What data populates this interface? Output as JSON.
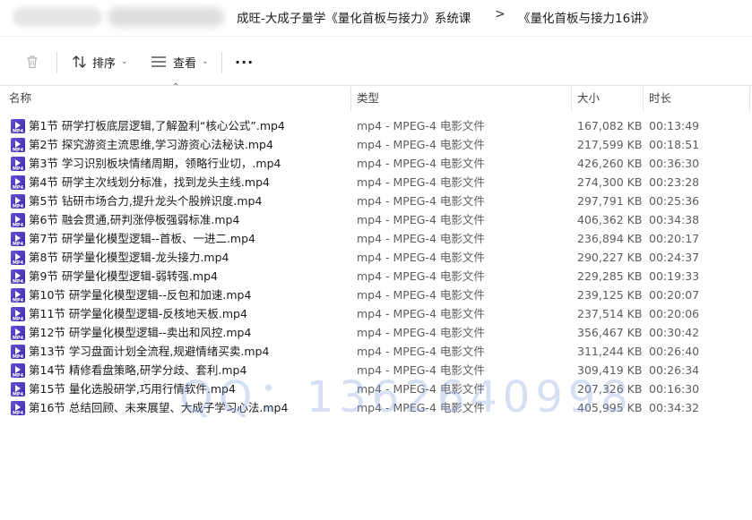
{
  "breadcrumb": {
    "items": [
      "成旺-大成子量学《量化首板与接力》系统课",
      "《量化首板与接力16讲》"
    ],
    "separator": ">"
  },
  "toolbar": {
    "sort_label": "排序",
    "view_label": "查看",
    "more_label": "···"
  },
  "columns": {
    "name": "名称",
    "type": "类型",
    "size": "大小",
    "duration": "时长"
  },
  "files": [
    {
      "name": "第1节 研学打板底层逻辑,了解盈利“核心公式”.mp4",
      "type": "mp4 - MPEG-4 电影文件",
      "size": "167,082 KB",
      "duration": "00:13:49"
    },
    {
      "name": "第2节 探究游资主流思维,学习游资心法秘诀.mp4",
      "type": "mp4 - MPEG-4 电影文件",
      "size": "217,599 KB",
      "duration": "00:18:51"
    },
    {
      "name": "第3节 学习识别板块情绪周期，领略行业切，.mp4",
      "type": "mp4 - MPEG-4 电影文件",
      "size": "426,260 KB",
      "duration": "00:36:30"
    },
    {
      "name": "第4节 研学主次线划分标准，找到龙头主线.mp4",
      "type": "mp4 - MPEG-4 电影文件",
      "size": "274,300 KB",
      "duration": "00:23:28"
    },
    {
      "name": "第5节 钻研市场合力,提升龙头个股辨识度.mp4",
      "type": "mp4 - MPEG-4 电影文件",
      "size": "297,791 KB",
      "duration": "00:25:36"
    },
    {
      "name": "第6节 融会贯通,研判涨停板强弱标准.mp4",
      "type": "mp4 - MPEG-4 电影文件",
      "size": "406,362 KB",
      "duration": "00:34:38"
    },
    {
      "name": "第7节 研学量化模型逻辑--首板、一进二.mp4",
      "type": "mp4 - MPEG-4 电影文件",
      "size": "236,894 KB",
      "duration": "00:20:17"
    },
    {
      "name": "第8节 研学量化模型逻辑-龙头接力.mp4",
      "type": "mp4 - MPEG-4 电影文件",
      "size": "290,227 KB",
      "duration": "00:24:37"
    },
    {
      "name": "第9节 研学量化模型逻辑-弱转强.mp4",
      "type": "mp4 - MPEG-4 电影文件",
      "size": "229,285 KB",
      "duration": "00:19:33"
    },
    {
      "name": "第10节 研学量化模型逻辑--反包和加速.mp4",
      "type": "mp4 - MPEG-4 电影文件",
      "size": "239,125 KB",
      "duration": "00:20:07"
    },
    {
      "name": "第11节 研学量化模型逻辑-反核地天板.mp4",
      "type": "mp4 - MPEG-4 电影文件",
      "size": "237,514 KB",
      "duration": "00:20:06"
    },
    {
      "name": "第12节 研学量化模型逻辑--卖出和风控.mp4",
      "type": "mp4 - MPEG-4 电影文件",
      "size": "356,467 KB",
      "duration": "00:30:42"
    },
    {
      "name": "第13节 学习盘面计划全流程,规避情绪买卖.mp4",
      "type": "mp4 - MPEG-4 电影文件",
      "size": "311,244 KB",
      "duration": "00:26:40"
    },
    {
      "name": "第14节 精修看盘策略,研学分歧、套利.mp4",
      "type": "mp4 - MPEG-4 电影文件",
      "size": "309,419 KB",
      "duration": "00:26:34"
    },
    {
      "name": "第15节 量化选股研学,巧用行情软件.mp4",
      "type": "mp4 - MPEG-4 电影文件",
      "size": "207,326 KB",
      "duration": "00:16:30"
    },
    {
      "name": "第16节 总结回顾、未来展望、大成子学习心法.mp4",
      "type": "mp4 - MPEG-4 电影文件",
      "size": "405,995 KB",
      "duration": "00:34:32"
    }
  ],
  "watermark": "QQ：1362640998",
  "colors": {
    "icon_purple": "#4b36c4",
    "text_secondary": "#5c5c5c",
    "watermark": "#a0b4e0"
  }
}
